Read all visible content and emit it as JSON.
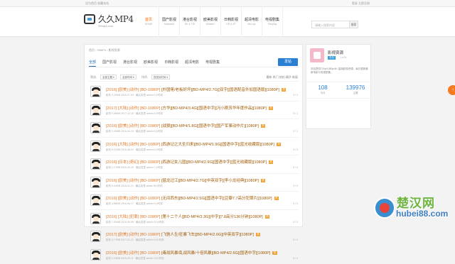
{
  "topbar": {
    "left": "设为首页  收藏本站",
    "right": "登录  立即注册"
  },
  "logo": {
    "title": "久久MP4",
    "subtitle": "99mp4.com"
  },
  "nav": [
    {
      "cn": "首页",
      "en": "HOME"
    },
    {
      "cn": "国产影视",
      "en": "Mainland"
    },
    {
      "cn": "港台影视",
      "en": "HK & TW"
    },
    {
      "cn": "欧美影视",
      "en": "Western"
    },
    {
      "cn": "日韩影视",
      "en": "KR & JP"
    },
    {
      "cn": "超清电影",
      "en": "Blu-ray"
    },
    {
      "cn": "电视剧集",
      "en": "Teleplay"
    }
  ],
  "search": {
    "placeholder": "请输入搜索内容",
    "button": "搜索"
  },
  "breadcrumb": "首页 › 99MP4 › 影视资源",
  "tabs": [
    "全部",
    "国产影视",
    "港台影视",
    "欧美影视",
    "日韩影视",
    "超清电影",
    "电视剧集"
  ],
  "post_button": "发帖",
  "filter": {
    "label1": "筛选:",
    "sel1": "全部主题 ▾",
    "sel2": "全部时间 ▾",
    "label2": "排序:",
    "sel3": "按发帖时间 ▾",
    "sorts": "最新   热门   热帖   精华   新窗"
  },
  "rows": [
    {
      "tag": "[2016] [欧美] [动作] [BD-1080P]",
      "title": "[外国佬/老板好坏][BD-MP4/2.7G][双字][国语配音外加国语版][1080P]",
      "meta": "影机  3.29MB  2016-07-02  ·  最后发表  admin  2小时前",
      "stats": "0 / 2"
    },
    {
      "tag": "[2017] [大陆] [动作] [BD-1080P]",
      "title": "[方华][BD-MP4/3.4G][国语中字][冯小刚芳华年度作品][1080P]",
      "meta": "影机  9.06MB  2017-12-15  ·  最后发表  admin  5小时前",
      "stats": "0 / 1"
    },
    {
      "tag": "[2016] [欧美] [动作] [BD-1080P]",
      "title": "[战狼][BD-MP4/1.8G][国语中字][国产军事动作片][1080P]",
      "meta": "影机  2.40MB  2016-04-19  ·  最后发表  admin  6小时前",
      "stats": "0 / 1"
    },
    {
      "tag": "[2016] [大陆] [动作] [BD-1080P]",
      "title": "[西游记之大圣归来][BD-MP4/1.9G][国语中字][蓝光收藏版][1080P]",
      "meta": "影机  8.21MB  2016-08-03  ·  最后发表  admin  6小时前",
      "stats": "0 / 0"
    },
    {
      "tag": "[2016] [日本] [奇幻] [BD-1080P]",
      "title": "[西游记女儿国][BD-MP4/2.9G][国语中字][蓝光收藏版][1080P]",
      "meta": "影机  1.17MB  2016-10-29  ·  最后发表  admin  7小时前",
      "stats": "0 / 0"
    },
    {
      "tag": "[2016] [欧美] [动作] [BD-1080P]",
      "title": "[猛龙过江][BD-MP4/2.7G][中英双字][李小龙经典][1080P]",
      "meta": "影机  6.04MB  2016-11-13  ·  最后发表  admin  8小时前",
      "stats": "0 / 0"
    },
    {
      "tag": "[2016] [欧美] [动作] [BD-1080P]",
      "title": "[无间西东][BD-MP4/2.5G][国语中字][豆瓣7.7高分犯罪片][1080P]",
      "meta": "影机  4.88MB  2016-06-17  ·  最后发表  admin  9小时前",
      "stats": "0 / 0"
    },
    {
      "tag": "[2016] [大陆] [犯罪] [BD-1080P]",
      "title": "[第十二个人][BD-MP4/3.3G][中字][7.8高分136分钟][1080P]",
      "meta": "影机  7.52MB  2016-09-08  ·  最后发表  admin  10小时前",
      "stats": "0 / 0"
    },
    {
      "tag": "[2017] [欧美] [动作] [BD-1080P]",
      "title": "[飞驰人生/狂暴飞车][BD-MP4/2.6G][中英双字][1080P]",
      "meta": "影机  3.77MB  2017-01-21  ·  最后发表  admin  11小时前",
      "stats": "0 / 0"
    },
    {
      "tag": "[2016] [欧美] [动作] [BD-1080P]",
      "title": "[毒战风暴/乱战风暴/十倍风暴][BD-MP4/2.6G][国语中字][1080P]",
      "meta": "影机  2.19MB  2016-05-11  ·  最后发表  admin  12小时前",
      "stats": "0 / 0"
    }
  ],
  "hot_label": "热",
  "side": {
    "name": "影视资源",
    "badge": "今日",
    "level": "Lv.25",
    "desc": "本站提供720p/1080p/4K 高清影视资源，每日更新最新电影与电视剧集。",
    "nums": [
      {
        "v": "108",
        "k": "今日"
      },
      {
        "v": "139976",
        "k": "主题"
      }
    ]
  },
  "fab": "↑",
  "watermark": {
    "big": "楚汉网",
    "url": "hubei88.com"
  }
}
